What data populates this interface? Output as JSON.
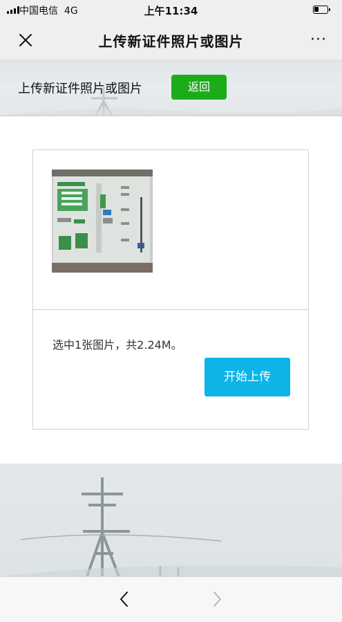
{
  "status_bar": {
    "carrier": "中国电信",
    "network": "4G",
    "time": "上午11:34"
  },
  "nav": {
    "title": "上传新证件照片或图片",
    "close_icon": "close-icon",
    "more_label": "···"
  },
  "header": {
    "title": "上传新证件照片或图片",
    "back_label": "返回",
    "back_color": "#1aad19"
  },
  "upload": {
    "info": "选中1张图片，共2.24M。",
    "start_label": "开始上传",
    "start_color": "#0cb4e8"
  },
  "toolbar": {
    "back_icon": "chevron-left-icon",
    "forward_icon": "chevron-right-icon"
  }
}
